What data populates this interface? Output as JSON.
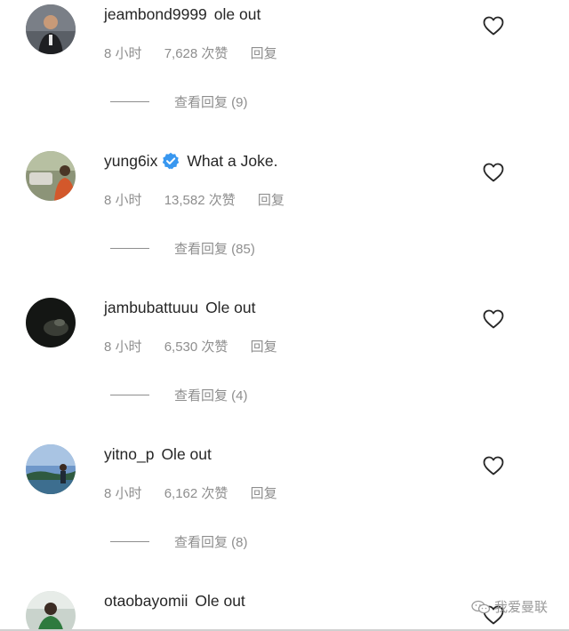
{
  "comments": [
    {
      "username": "jeambond9999",
      "text": "ole out",
      "verified": false,
      "time": "8 小时",
      "likes": "7,628 次赞",
      "reply_label": "回复",
      "view_replies": "查看回复 (9)",
      "avatar_colors": [
        "#6b6f75",
        "#2a2c30"
      ]
    },
    {
      "username": "yung6ix",
      "text": "What a Joke.",
      "verified": true,
      "time": "8 小时",
      "likes": "13,582 次赞",
      "reply_label": "回复",
      "view_replies": "查看回复 (85)",
      "avatar_colors": [
        "#7e8a6c",
        "#3b3f33"
      ]
    },
    {
      "username": "jambubattuuu",
      "text": "Ole out",
      "verified": false,
      "time": "8 小时",
      "likes": "6,530 次赞",
      "reply_label": "回复",
      "view_replies": "查看回复 (4)",
      "avatar_colors": [
        "#1d1f1c",
        "#0b0c0b"
      ]
    },
    {
      "username": "yitno_p",
      "text": "Ole out",
      "verified": false,
      "time": "8 小时",
      "likes": "6,162 次赞",
      "reply_label": "回复",
      "view_replies": "查看回复 (8)",
      "avatar_colors": [
        "#5b83b8",
        "#2e4f3c"
      ]
    },
    {
      "username": "otaobayomii",
      "text": "Ole out",
      "verified": false,
      "avatar_colors": [
        "#8fa79a",
        "#2f3a30"
      ]
    }
  ],
  "icons": {
    "heart": "heart-icon",
    "verified": "verified-badge-icon"
  },
  "colors": {
    "text": "#262626",
    "muted": "#8e8e8e",
    "verified": "#3897f0"
  },
  "watermark": {
    "text": "我爱曼联"
  }
}
